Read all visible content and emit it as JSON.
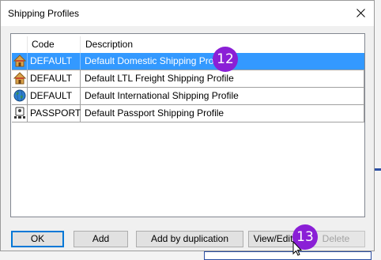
{
  "dialog": {
    "title": "Shipping Profiles"
  },
  "table": {
    "columns": [
      "",
      "Code",
      "Description"
    ],
    "rows": [
      {
        "icon": "house-icon",
        "code": "DEFAULT",
        "description": "Default Domestic Shipping Profile",
        "selected": true
      },
      {
        "icon": "house-icon",
        "code": "DEFAULT",
        "description": "Default LTL Freight Shipping Profile",
        "selected": false
      },
      {
        "icon": "globe-icon",
        "code": "DEFAULT",
        "description": "Default International Shipping Profile",
        "selected": false
      },
      {
        "icon": "passport-icon",
        "code": "PASSPORT",
        "description": "Default Passport Shipping Profile",
        "selected": false
      }
    ]
  },
  "buttons": {
    "ok": "OK",
    "add": "Add",
    "add_dup": "Add by duplication",
    "view_edit": "View/Edit",
    "delete": "Delete"
  },
  "annotations": {
    "step_a": "12",
    "step_b": "13"
  },
  "colors": {
    "selection": "#3399ff",
    "badge": "#8a1fd6",
    "default_button_border": "#0078d7"
  }
}
